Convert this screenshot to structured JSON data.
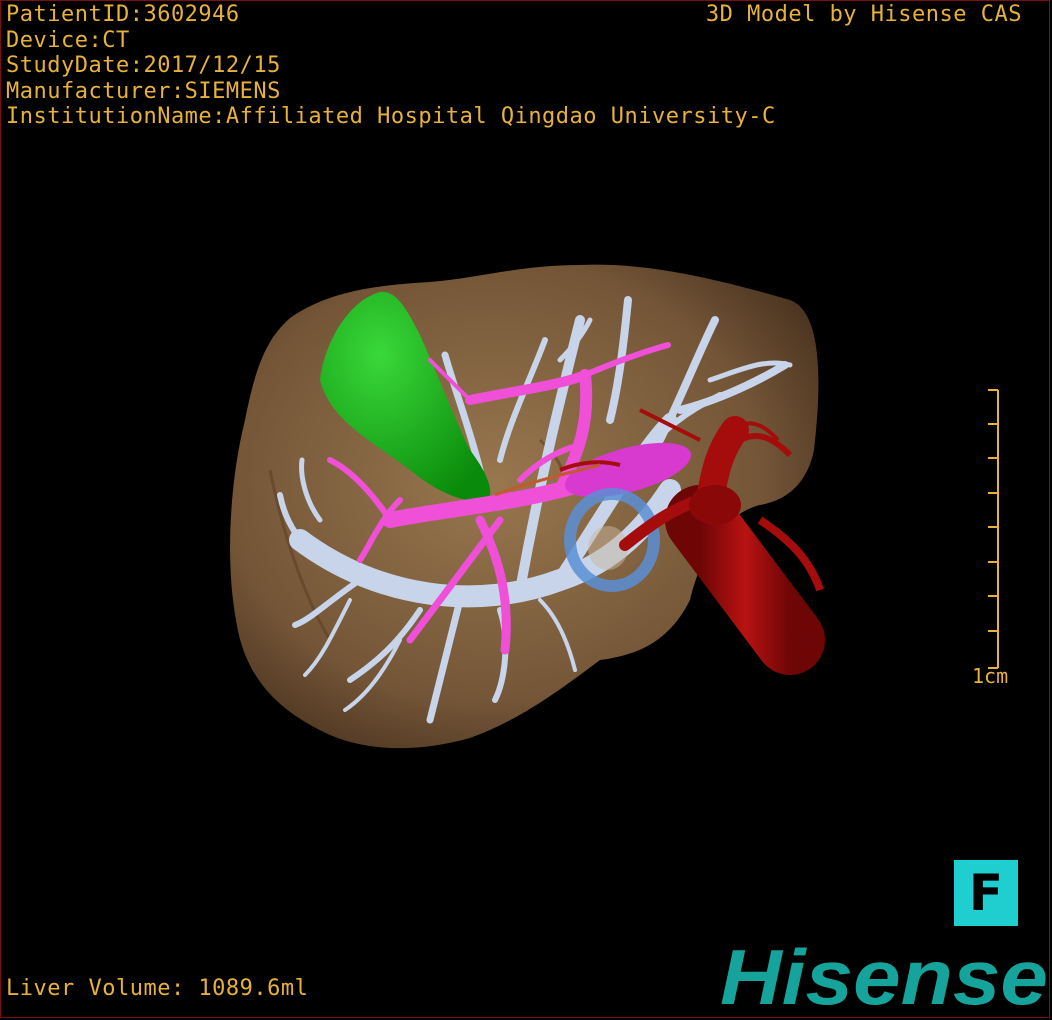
{
  "header": {
    "patient_id": "PatientID:3602946",
    "device": "Device:CT",
    "study_date": "StudyDate:2017/12/15",
    "manufacturer": "Manufacturer:SIEMENS",
    "institution": "InstitutionName:Affiliated Hospital Qingdao University-C"
  },
  "brand_caption": "3D Model by Hisense CAS",
  "scale_bar": {
    "label": "1cm"
  },
  "orientation": {
    "label": "F"
  },
  "footer": {
    "liver_volume": "Liver Volume: 1089.6ml"
  },
  "logo": {
    "text": "Hisense",
    "color": "#16a39b"
  },
  "model": {
    "liver_color": "#8a6a45",
    "gallbladder_color": "#17b317",
    "hepatic_vein_color": "#c7d4ea",
    "portal_vein_color": "#f04fd8",
    "artery_color": "#a50c0c",
    "duct_ring_color": "#5a8fd6"
  },
  "colors": {
    "text": "#e8b23a",
    "frame": "#7a1010",
    "orientation_bg": "#1fcfd0"
  }
}
